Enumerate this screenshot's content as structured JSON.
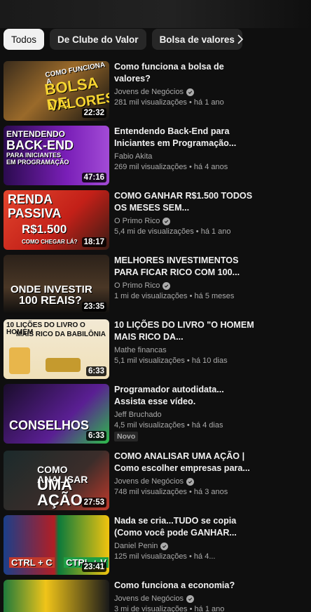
{
  "chips": [
    {
      "label": "Todos",
      "active": true
    },
    {
      "label": "De Clube do Valor",
      "active": false
    },
    {
      "label": "Bolsa de valores",
      "active": false
    }
  ],
  "videos": [
    {
      "title": "Como funciona a bolsa de valores?",
      "channel": "Jovens de Negócios",
      "verified": true,
      "views": "281 mil visualizações",
      "age": "há 1 ano",
      "duration": "22:32",
      "thumb_text": [
        "COMO FUNCIONA A",
        "BOLSA DE",
        "VALORES?"
      ],
      "badge": ""
    },
    {
      "title": "Entendendo Back-End para Iniciantes em Programação...",
      "channel": "Fabio Akita",
      "verified": false,
      "views": "269 mil visualizações",
      "age": "há 4 anos",
      "duration": "47:16",
      "thumb_text": [
        "ENTENDENDO",
        "BACK-END",
        "PARA INICIANTES",
        "EM PROGRAMAÇÃO"
      ],
      "badge": ""
    },
    {
      "title": "COMO GANHAR R$1.500 TODOS OS MESES SEM...",
      "channel": "O Primo Rico",
      "verified": true,
      "views": "5,4 mi de visualizações",
      "age": "há 1 ano",
      "duration": "18:17",
      "thumb_text": [
        "RENDA",
        "PASSIVA",
        "R$1.500",
        "COMO CHEGAR LÁ?"
      ],
      "badge": ""
    },
    {
      "title": "MELHORES INVESTIMENTOS PARA FICAR RICO COM 100...",
      "channel": "O Primo Rico",
      "verified": true,
      "views": "1 mi de visualizações",
      "age": "há 5 meses",
      "duration": "23:35",
      "thumb_text": [
        "ONDE INVESTIR",
        "100 REAIS?"
      ],
      "badge": ""
    },
    {
      "title": "10 LIÇÕES DO LIVRO \"O HOMEM MAIS RICO DA...",
      "channel": "Mathe financas",
      "verified": false,
      "views": "5,1 mil visualizações",
      "age": "há 10 dias",
      "duration": "6:33",
      "thumb_text": [
        "10 LIÇÕES DO LIVRO O HOMEM",
        "MAIS RICO DA BABILÔNIA"
      ],
      "badge": ""
    },
    {
      "title": "Programador autodidata... Assista esse vídeo.",
      "channel": "Jeff Bruchado",
      "verified": false,
      "views": "4,5 mil visualizações",
      "age": "há 4 dias",
      "duration": "6:33",
      "thumb_text": [
        "CONSELHOS"
      ],
      "badge": "Novo"
    },
    {
      "title": "COMO ANALISAR UMA AÇÃO | Como escolher empresas para...",
      "channel": "Jovens de Negócios",
      "verified": true,
      "views": "748 mil visualizações",
      "age": "há 3 anos",
      "duration": "27:53",
      "thumb_text": [
        "COMO ANALISAR",
        "UMA AÇÃO"
      ],
      "badge": ""
    },
    {
      "title": "Nada se cria...TUDO se copia (Como você pode GANHAR...",
      "channel": "Daniel Penin",
      "verified": true,
      "views": "125 mil visualizações",
      "age": "há 4...",
      "duration": "23:41",
      "thumb_text": [
        "CTRL + C",
        "CTRL + V"
      ],
      "badge": ""
    },
    {
      "title": "Como funciona a economia?",
      "channel": "Jovens de Negócios",
      "verified": true,
      "views": "3 mi de visualizações",
      "age": "há 1 ano",
      "duration": "",
      "thumb_text": [],
      "badge": ""
    }
  ],
  "colors": {
    "background": "#0f0f0f",
    "chip": "#272727",
    "chip_active": "#f1f1f1",
    "meta_text": "#aaaaaa"
  }
}
